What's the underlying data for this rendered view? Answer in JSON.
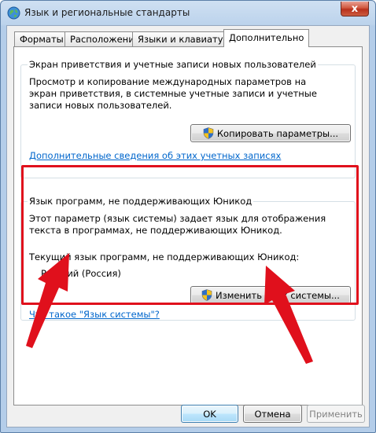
{
  "window": {
    "title": "Язык и региональные стандарты",
    "close_glyph": "x"
  },
  "tabs": [
    {
      "label": "Форматы",
      "active": false
    },
    {
      "label": "Расположение",
      "active": false
    },
    {
      "label": "Языки и клавиатуры",
      "active": false
    },
    {
      "label": "Дополнительно",
      "active": true
    }
  ],
  "welcome": {
    "title": "Экран приветствия и учетные записи новых пользователей",
    "description": "Просмотр и копирование международных параметров на экран приветствия, в системные учетные записи и учетные записи новых пользователей.",
    "copy_button": "Копировать параметры...",
    "link": "Дополнительные сведения об этих учетных записях"
  },
  "nonunicode": {
    "title": "Язык программ, не поддерживающих Юникод",
    "description": "Этот параметр (язык системы) задает язык для отображения текста в программах, не поддерживающих Юникод.",
    "current_label": "Текущий язык программ, не поддерживающих Юникод:",
    "current_value": "Русский (Россия)",
    "change_button": "Изменить язык системы...",
    "link": "Что такое \"Язык системы\"?"
  },
  "footer": {
    "ok": "OK",
    "cancel": "Отмена",
    "apply": "Применить"
  },
  "colors": {
    "highlight": "#e0101c",
    "link": "#0066cc",
    "accent": "#3c7fb1"
  },
  "icons": {
    "title": "globe-icon",
    "buttons": "uac-shield-icon"
  }
}
